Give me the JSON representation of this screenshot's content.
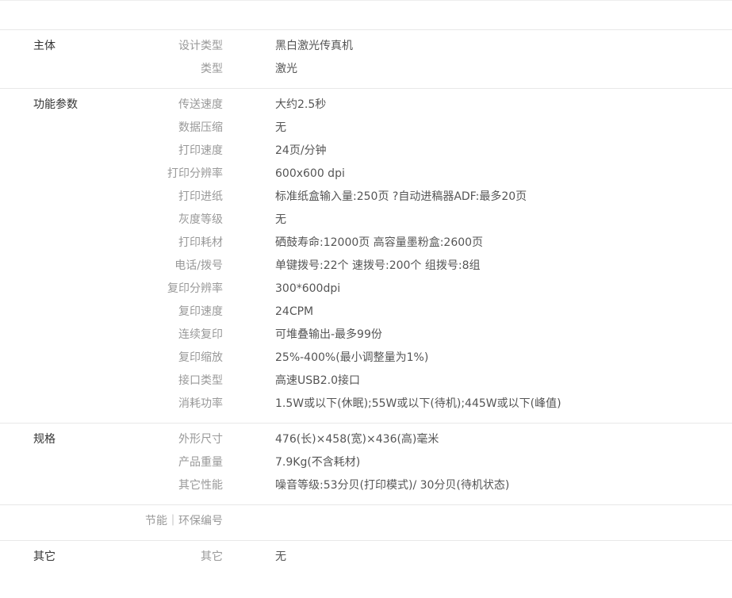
{
  "sections": [
    {
      "name": "主体",
      "rows": [
        {
          "label": "设计类型",
          "value": "黑白激光传真机"
        },
        {
          "label": "类型",
          "value": "激光"
        }
      ]
    },
    {
      "name": "功能参数",
      "rows": [
        {
          "label": "传送速度",
          "value": "大约2.5秒"
        },
        {
          "label": "数据压缩",
          "value": "无"
        },
        {
          "label": "打印速度",
          "value": "24页/分钟"
        },
        {
          "label": "打印分辨率",
          "value": "600x600 dpi"
        },
        {
          "label": "打印进纸",
          "value": "标准纸盒输入量:250页 ?自动进稿器ADF:最多20页"
        },
        {
          "label": "灰度等级",
          "value": "无"
        },
        {
          "label": "打印耗材",
          "value": "硒鼓寿命:12000页 高容量墨粉盒:2600页"
        },
        {
          "label": "电话/拨号",
          "value": "单键拨号:22个 速拨号:200个 组拨号:8组"
        },
        {
          "label": "复印分辨率",
          "value": "300*600dpi"
        },
        {
          "label": "复印速度",
          "value": "24CPM"
        },
        {
          "label": "连续复印",
          "value": "可堆叠输出-最多99份"
        },
        {
          "label": "复印缩放",
          "value": "25%-400%(最小调整量为1%)"
        },
        {
          "label": "接口类型",
          "value": "高速USB2.0接口"
        },
        {
          "label": "消耗功率",
          "value": "1.5W或以下(休眠);55W或以下(待机);445W或以下(峰值)"
        }
      ]
    },
    {
      "name": "规格",
      "rows": [
        {
          "label": "外形尺寸",
          "value": "476(长)×458(宽)×436(高)毫米"
        },
        {
          "label": "产品重量",
          "value": "7.9Kg(不含耗材)"
        },
        {
          "label": "其它性能",
          "value": "噪音等级:53分贝(打印模式)/ 30分贝(待机状态)"
        }
      ]
    },
    {
      "name": "",
      "rows": [
        {
          "label": "节能｜环保编号",
          "value": ""
        }
      ]
    },
    {
      "name": "其它",
      "rows": [
        {
          "label": "其它",
          "value": "无"
        }
      ]
    }
  ]
}
